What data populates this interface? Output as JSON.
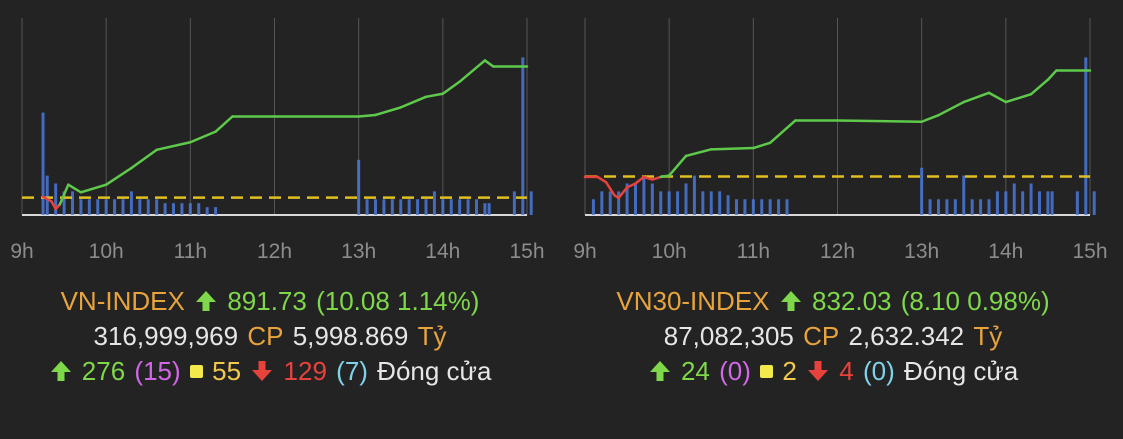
{
  "colors": {
    "background": "#232323",
    "grid": "#555555",
    "line_up": "#5ec94a",
    "line_down": "#e8423d",
    "reference": "#e0c020",
    "volume": "#4a78d8"
  },
  "icons": {
    "up": "arrow-up-icon",
    "down": "arrow-down-icon",
    "unchanged": "square-icon"
  },
  "panels": [
    {
      "name": "VN-INDEX",
      "up_icon": "arrow-up-icon",
      "value": "891.73",
      "change": "(10.08 1.14%)",
      "volume": "316,999,969",
      "cp": "CP",
      "amount": "5,998.869",
      "unit": "Tỷ",
      "advances": "276",
      "advances_ceiling": "(15)",
      "unchanged": "55",
      "declines": "129",
      "declines_floor": "(7)",
      "status": "Đóng cửa"
    },
    {
      "name": "VN30-INDEX",
      "up_icon": "arrow-up-icon",
      "value": "832.03",
      "change": "(8.10 0.98%)",
      "volume": "87,082,305",
      "cp": "CP",
      "amount": "2,632.342",
      "unit": "Tỷ",
      "advances": "24",
      "advances_ceiling": "(0)",
      "unchanged": "2",
      "declines": "4",
      "declines_floor": "(0)",
      "status": "Đóng cửa"
    }
  ],
  "chart_data": [
    {
      "type": "line",
      "title": "VN-INDEX",
      "x_ticks": [
        "9h",
        "10h",
        "11h",
        "12h",
        "13h",
        "14h",
        "15h"
      ],
      "xlim": [
        9.0,
        15.0
      ],
      "ylim": [
        880.5,
        893.5
      ],
      "reference": 881.65,
      "grid": true,
      "series": [
        {
          "x": [
            9.25,
            9.35,
            9.4,
            9.45,
            9.55,
            9.7,
            10.0,
            10.3,
            10.6,
            11.0,
            11.3,
            11.5,
            12.0,
            13.0,
            13.2,
            13.5,
            13.8,
            14.0,
            14.2,
            14.5,
            14.6,
            15.0
          ],
          "y": [
            881.7,
            881.4,
            880.9,
            881.2,
            882.5,
            882.0,
            882.5,
            883.6,
            884.8,
            885.3,
            886.0,
            887.0,
            887.0,
            887.0,
            887.1,
            887.6,
            888.3,
            888.5,
            889.3,
            890.7,
            890.3,
            890.3
          ]
        }
      ],
      "volume": [
        [
          9.25,
          13
        ],
        [
          9.3,
          5
        ],
        [
          9.4,
          4
        ],
        [
          9.5,
          3
        ],
        [
          9.6,
          3
        ],
        [
          9.7,
          2
        ],
        [
          9.8,
          2
        ],
        [
          9.9,
          2
        ],
        [
          10.0,
          2
        ],
        [
          10.1,
          2
        ],
        [
          10.2,
          2
        ],
        [
          10.3,
          3
        ],
        [
          10.4,
          2
        ],
        [
          10.5,
          2
        ],
        [
          10.6,
          2
        ],
        [
          10.7,
          1.5
        ],
        [
          10.8,
          1.5
        ],
        [
          10.9,
          1.5
        ],
        [
          11.0,
          1.5
        ],
        [
          11.1,
          1.5
        ],
        [
          11.2,
          1
        ],
        [
          11.3,
          1
        ],
        [
          13.0,
          7
        ],
        [
          13.1,
          2
        ],
        [
          13.2,
          2
        ],
        [
          13.3,
          2
        ],
        [
          13.4,
          2
        ],
        [
          13.5,
          2
        ],
        [
          13.6,
          2
        ],
        [
          13.7,
          2
        ],
        [
          13.8,
          2
        ],
        [
          13.9,
          3
        ],
        [
          14.0,
          2
        ],
        [
          14.1,
          2
        ],
        [
          14.2,
          2
        ],
        [
          14.3,
          2
        ],
        [
          14.4,
          2
        ],
        [
          14.5,
          1.5
        ],
        [
          14.55,
          1.5
        ],
        [
          14.85,
          3
        ],
        [
          14.95,
          20
        ],
        [
          15.05,
          3
        ]
      ]
    },
    {
      "type": "line",
      "title": "VN30-INDEX",
      "x_ticks": [
        "9h",
        "10h",
        "11h",
        "12h",
        "13h",
        "14h",
        "15h"
      ],
      "xlim": [
        9.0,
        15.0
      ],
      "ylim": [
        821.0,
        836.0
      ],
      "reference": 823.93,
      "grid": true,
      "series": [
        {
          "x": [
            9.0,
            9.15,
            9.25,
            9.35,
            9.4,
            9.5,
            9.6,
            9.7,
            9.8,
            9.9,
            10.0,
            10.2,
            10.5,
            11.0,
            11.2,
            11.5,
            12.0,
            13.0,
            13.2,
            13.5,
            13.8,
            14.0,
            14.3,
            14.5,
            14.6,
            15.0
          ],
          "y": [
            823.9,
            823.9,
            823.5,
            822.5,
            822.3,
            823.1,
            823.4,
            823.9,
            823.7,
            823.9,
            824.0,
            825.5,
            826.0,
            826.1,
            826.5,
            828.2,
            828.2,
            828.1,
            828.6,
            829.6,
            830.3,
            829.6,
            830.2,
            831.3,
            832.0,
            832.0
          ]
        }
      ],
      "volume": [
        [
          9.1,
          2
        ],
        [
          9.2,
          3
        ],
        [
          9.3,
          3
        ],
        [
          9.4,
          3
        ],
        [
          9.5,
          4
        ],
        [
          9.6,
          4
        ],
        [
          9.7,
          5
        ],
        [
          9.8,
          4
        ],
        [
          9.9,
          3
        ],
        [
          10.0,
          3
        ],
        [
          10.1,
          3
        ],
        [
          10.2,
          4
        ],
        [
          10.3,
          5
        ],
        [
          10.4,
          3
        ],
        [
          10.5,
          3
        ],
        [
          10.6,
          3
        ],
        [
          10.7,
          2.5
        ],
        [
          10.8,
          2
        ],
        [
          10.9,
          2
        ],
        [
          11.0,
          2
        ],
        [
          11.1,
          2
        ],
        [
          11.2,
          2
        ],
        [
          11.3,
          2
        ],
        [
          11.4,
          2
        ],
        [
          13.0,
          6
        ],
        [
          13.1,
          2
        ],
        [
          13.2,
          2
        ],
        [
          13.3,
          2
        ],
        [
          13.4,
          2
        ],
        [
          13.5,
          5
        ],
        [
          13.6,
          2
        ],
        [
          13.7,
          2
        ],
        [
          13.8,
          2
        ],
        [
          13.9,
          3
        ],
        [
          14.0,
          3
        ],
        [
          14.1,
          4
        ],
        [
          14.2,
          3
        ],
        [
          14.3,
          4
        ],
        [
          14.4,
          3
        ],
        [
          14.5,
          3
        ],
        [
          14.55,
          3
        ],
        [
          14.85,
          3
        ],
        [
          14.95,
          20
        ],
        [
          15.05,
          3
        ]
      ]
    }
  ]
}
